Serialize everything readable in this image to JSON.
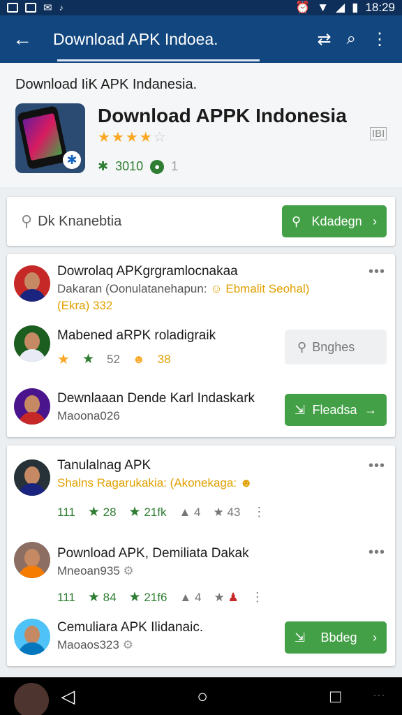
{
  "status_bar": {
    "time": "18:29"
  },
  "app_bar": {
    "title": "Download APK Indoea."
  },
  "header": {
    "subtitle": "Download IiK APK Indanesia.",
    "app_name": "Download APPK Indonesia",
    "stars_filled": "★★★★",
    "stars_empty": "☆",
    "tag": "IBI",
    "meta_value": "3010",
    "meta_count": "1"
  },
  "search": {
    "placeholder": "Dk Knanebtia",
    "button_label": "Kdadegn"
  },
  "card1": {
    "rows": [
      {
        "title": "Dowrolaq APKgrgramlocnakaa",
        "sub1": "Dakaran (Oonulatanehapun:",
        "sub1_highlight": "Ebmalit Seohal)",
        "sub2": "(Ekra) 332"
      },
      {
        "title": "Mabened aRPK roladigraik",
        "rating": "52",
        "rating2": "38",
        "button_label": "Bnghes"
      },
      {
        "title": "Dewnlaaan Dende Karl Indaskark",
        "sub": "Maoona026",
        "button_label": "Fleadsa"
      }
    ]
  },
  "card2": {
    "rows": [
      {
        "title": "Tanulalnag APK",
        "sub": "Shalns Ragarukakia: (Akonekaga:",
        "stat1": "111",
        "stat2": "28",
        "stat3": "21fk",
        "stat4": "4",
        "stat5": "43"
      },
      {
        "title": "Pownload APK, Demiliata Dakak",
        "sub": "Mneoan935",
        "stat1": "111",
        "stat2": "84",
        "stat3": "21f6",
        "stat4": "4"
      },
      {
        "title": "Cemuliara APK Ilidanaic.",
        "sub": "Maoaos323",
        "button_label": "Bbdeg"
      }
    ]
  },
  "colors": {
    "primary": "#11467f",
    "status": "#0d2f5a",
    "accent": "#43a047",
    "star": "#f9a825"
  }
}
